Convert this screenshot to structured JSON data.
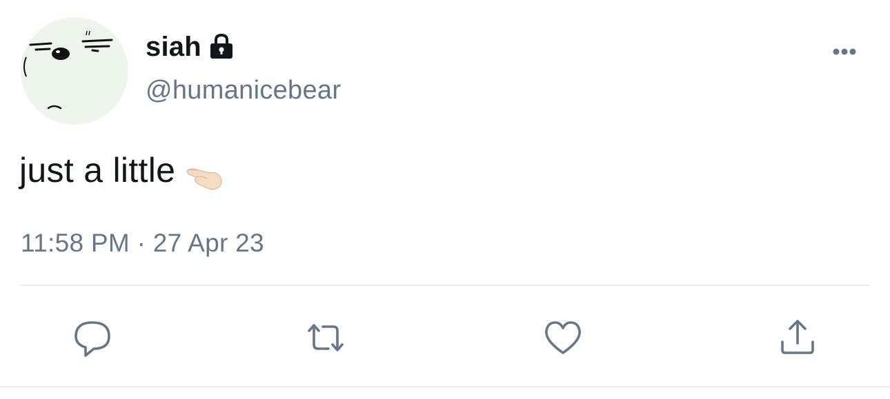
{
  "user": {
    "display_name": "siah",
    "handle": "@humanicebear",
    "protected": true,
    "avatar_icon": "bear-face-avatar"
  },
  "tweet": {
    "text": "just a little",
    "emoji": "pinching-hand",
    "timestamp": "11:58 PM · 27 Apr 23"
  },
  "actions": [
    {
      "name": "reply",
      "icon": "comment-icon"
    },
    {
      "name": "retweet",
      "icon": "retweet-icon"
    },
    {
      "name": "like",
      "icon": "heart-icon"
    },
    {
      "name": "share",
      "icon": "share-icon"
    }
  ],
  "colors": {
    "text": "#14171a",
    "secondary": "#657786",
    "divider": "#e6ecf0",
    "avatar_bg": "#eef5ec"
  }
}
